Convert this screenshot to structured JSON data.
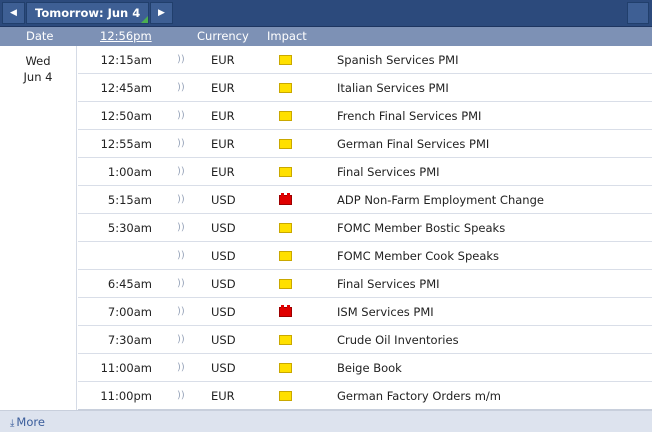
{
  "nav": {
    "prev_icon": "◀",
    "next_icon": "▶",
    "day_label": "Tomorrow: Jun 4"
  },
  "columns": {
    "date": "Date",
    "time": "12:56pm",
    "currency": "Currency",
    "impact": "Impact"
  },
  "date_group": {
    "weekday": "Wed",
    "day": "Jun 4"
  },
  "impact_colors": {
    "yellow": "#ffe000",
    "red": "#e00000"
  },
  "events": [
    {
      "time": "12:15am",
      "currency": "EUR",
      "impact": "yellow",
      "name": "Spanish Services PMI"
    },
    {
      "time": "12:45am",
      "currency": "EUR",
      "impact": "yellow",
      "name": "Italian Services PMI"
    },
    {
      "time": "12:50am",
      "currency": "EUR",
      "impact": "yellow",
      "name": "French Final Services PMI"
    },
    {
      "time": "12:55am",
      "currency": "EUR",
      "impact": "yellow",
      "name": "German Final Services PMI"
    },
    {
      "time": "1:00am",
      "currency": "EUR",
      "impact": "yellow",
      "name": "Final Services PMI"
    },
    {
      "time": "5:15am",
      "currency": "USD",
      "impact": "red",
      "name": "ADP Non-Farm Employment Change"
    },
    {
      "time": "5:30am",
      "currency": "USD",
      "impact": "yellow",
      "name": "FOMC Member Bostic Speaks"
    },
    {
      "time": "",
      "currency": "USD",
      "impact": "yellow",
      "name": "FOMC Member Cook Speaks"
    },
    {
      "time": "6:45am",
      "currency": "USD",
      "impact": "yellow",
      "name": "Final Services PMI"
    },
    {
      "time": "7:00am",
      "currency": "USD",
      "impact": "red",
      "name": "ISM Services PMI"
    },
    {
      "time": "7:30am",
      "currency": "USD",
      "impact": "yellow",
      "name": "Crude Oil Inventories"
    },
    {
      "time": "11:00am",
      "currency": "USD",
      "impact": "yellow",
      "name": "Beige Book"
    },
    {
      "time": "11:00pm",
      "currency": "EUR",
      "impact": "yellow",
      "name": "German Factory Orders m/m"
    }
  ],
  "footer": {
    "more_icon": "⤓",
    "more_label": "More"
  }
}
